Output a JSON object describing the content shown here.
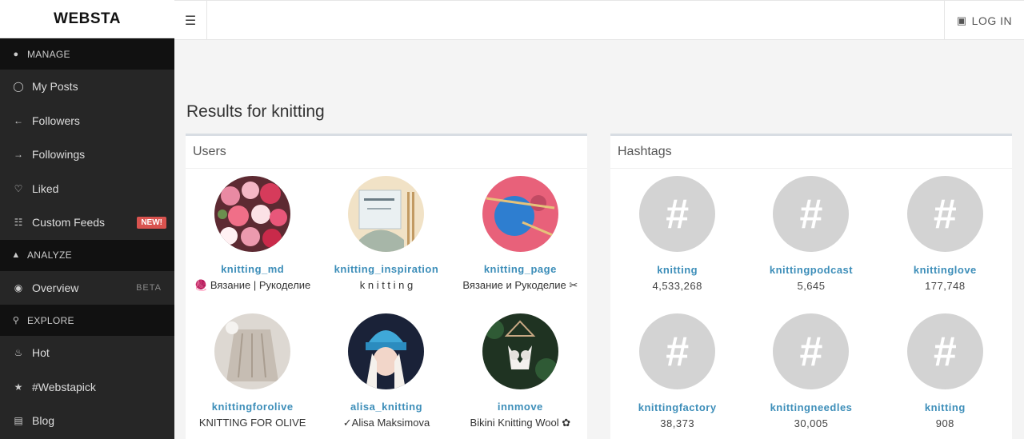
{
  "app": {
    "logo": "WEBSTA"
  },
  "header": {
    "menu_icon": "hamburger-icon",
    "login_label": "LOG IN",
    "login_icon": "instagram-icon"
  },
  "sidebar": {
    "sections": [
      {
        "label": "MANAGE",
        "icon": "user-icon",
        "items": [
          {
            "label": "My Posts",
            "icon": "instagram-icon"
          },
          {
            "label": "Followers",
            "icon": "arrow-left-icon"
          },
          {
            "label": "Followings",
            "icon": "arrow-right-icon"
          },
          {
            "label": "Liked",
            "icon": "heart-icon"
          },
          {
            "label": "Custom Feeds",
            "icon": "grid-icon",
            "badge": "NEW!"
          }
        ]
      },
      {
        "label": "ANALYZE",
        "icon": "chart-icon",
        "items": [
          {
            "label": "Overview",
            "icon": "dashboard-icon",
            "badge": "BETA"
          }
        ]
      },
      {
        "label": "EXPLORE",
        "icon": "search-icon",
        "items": [
          {
            "label": "Hot",
            "icon": "fire-icon"
          },
          {
            "label": "#Webstapick",
            "icon": "trophy-icon"
          },
          {
            "label": "Blog",
            "icon": "document-icon"
          }
        ]
      }
    ]
  },
  "main": {
    "title": "Results for knitting",
    "users_panel": {
      "heading": "Users",
      "users": [
        {
          "username": "knitting_md",
          "bio": "🧶 Вязание | Рукоделие"
        },
        {
          "username": "knitting_inspiration",
          "bio": "k n i t t i n g"
        },
        {
          "username": "knitting_page",
          "bio": "Вязание и Рукоделие ✂"
        },
        {
          "username": "knittingforolive",
          "bio": "KNITTING FOR OLIVE"
        },
        {
          "username": "alisa_knitting",
          "bio": "✓Alisa Maksimova"
        },
        {
          "username": "innmove",
          "bio": "Bikini Knitting Wool ✿"
        }
      ]
    },
    "hashtags_panel": {
      "heading": "Hashtags",
      "hash_symbol": "#",
      "tags": [
        {
          "name": "knitting",
          "count": "4,533,268"
        },
        {
          "name": "knittingpodcast",
          "count": "5,645"
        },
        {
          "name": "knittinglove",
          "count": "177,748"
        },
        {
          "name": "knittingfactory",
          "count": "38,373"
        },
        {
          "name": "knittingneedles",
          "count": "30,005"
        },
        {
          "name": "knitting",
          "count": "908"
        }
      ]
    }
  }
}
